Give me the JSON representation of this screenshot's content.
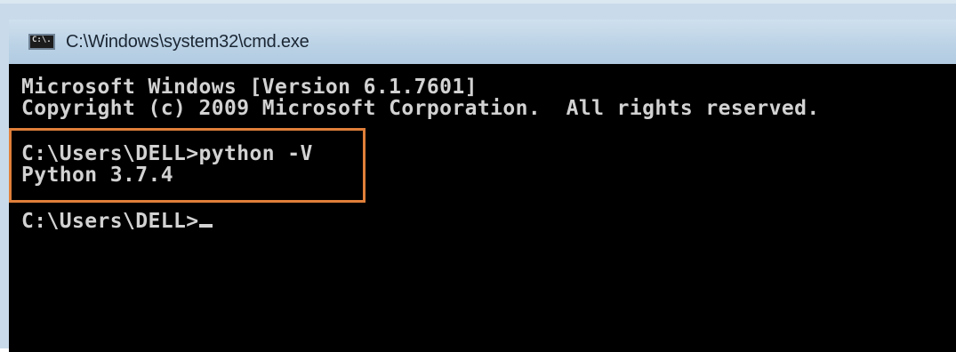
{
  "window": {
    "title": "C:\\Windows\\system32\\cmd.exe",
    "icon": "cmd-icon",
    "icon_glyph": "C:\\."
  },
  "console": {
    "lines": [
      "Microsoft Windows [Version 6.1.7601]",
      "Copyright (c) 2009 Microsoft Corporation.  All rights reserved.",
      "",
      "C:\\Users\\DELL>python -V",
      "Python 3.7.4",
      "",
      "C:\\Users\\DELL>"
    ],
    "background_color": "#000000",
    "text_color": "#d2d2d2"
  },
  "highlight": {
    "color": "#e07f3a",
    "covers_lines": [
      "C:\\Users\\DELL>python -V",
      "Python 3.7.4"
    ]
  }
}
